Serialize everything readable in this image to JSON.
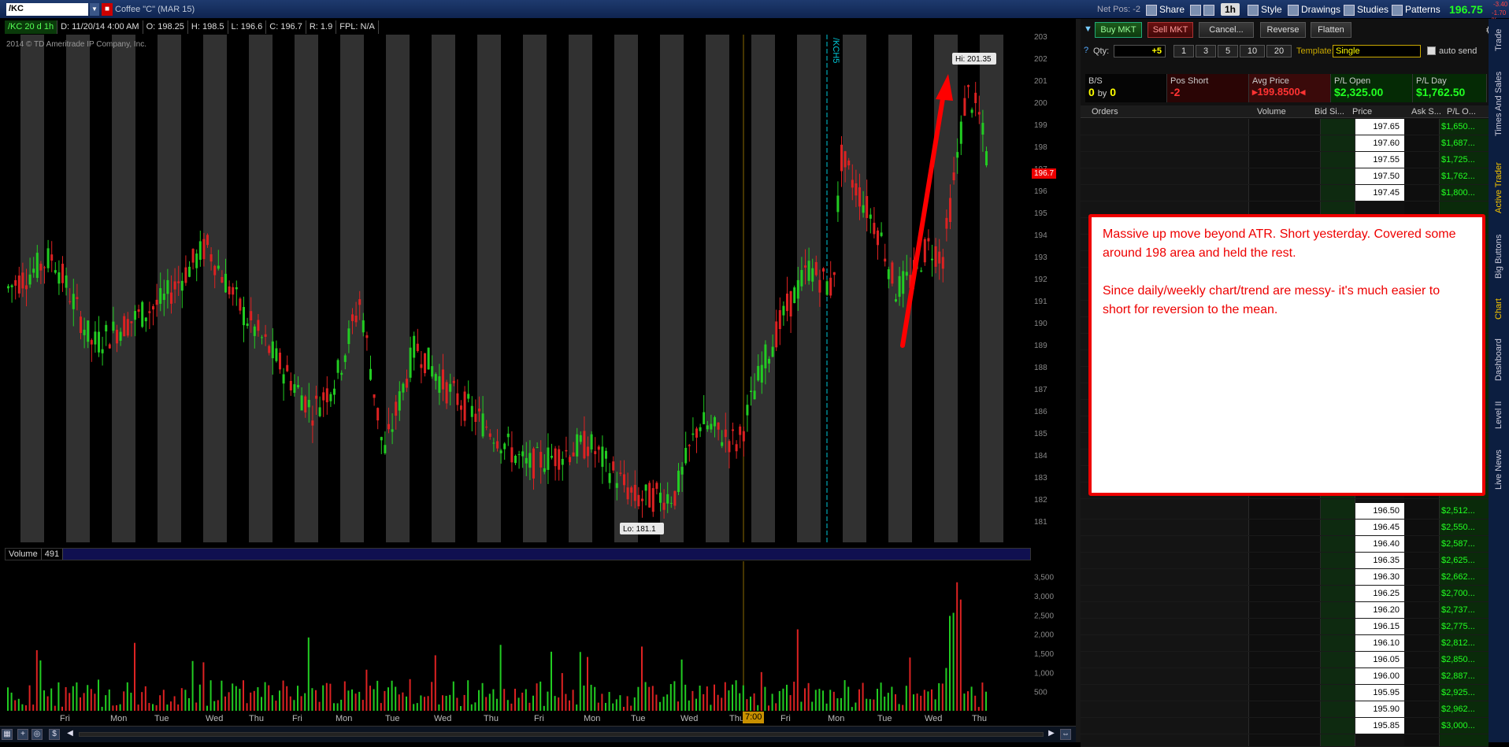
{
  "topbar": {
    "symbol": "/KC",
    "description": "Coffee \"C\" (MAR 15)",
    "net_pos": "Net Pos: -2",
    "share": "Share",
    "timeframe": "1h",
    "style": "Style",
    "drawings": "Drawings",
    "studies": "Studies",
    "patterns": "Patterns",
    "last_price": "196.75",
    "change_1": "-3.40",
    "change_2": "-1.70 %"
  },
  "infobar": {
    "period": "/KC 20 d 1h",
    "date": "D: 11/20/14 4:00 AM",
    "open": "O: 198.25",
    "high": "H: 198.5",
    "low": "L: 196.6",
    "close": "C: 196.7",
    "range": "R: 1.9",
    "fpl": "FPL: N/A"
  },
  "copyright": "2014 © TD Ameritrade IP Company, Inc.",
  "price_chart": {
    "y_ticks": [
      "203",
      "202",
      "201",
      "200",
      "199",
      "198",
      "197",
      "196",
      "195",
      "194",
      "193",
      "192",
      "191",
      "190",
      "189",
      "188",
      "187",
      "186",
      "185",
      "184",
      "183",
      "182",
      "181"
    ],
    "hi_label": "Hi: 201.35",
    "lo_label": "Lo: 181.1",
    "current_price": "196.7",
    "contract_label": "/KCH5",
    "colors": {
      "up": "#22cc22",
      "down": "#dd2222",
      "session_band": "#3a3a3a",
      "annotation": "#ff0000",
      "contract_line": "#00c8d8"
    }
  },
  "volume": {
    "label": "Volume",
    "value": "491",
    "y_ticks": [
      "3,500",
      "3,000",
      "2,500",
      "2,000",
      "1,500",
      "1,000",
      "500"
    ]
  },
  "x_axis": {
    "labels": [
      "Fri",
      "Mon",
      "Tue",
      "Wed",
      "Thu",
      "Fri",
      "Mon",
      "Tue",
      "Wed",
      "Thu",
      "Fri",
      "Mon",
      "Tue",
      "Wed",
      "Thu",
      "Fri",
      "Mon",
      "Tue",
      "Wed",
      "Thu"
    ],
    "time_marker": "7:00"
  },
  "active_trader": {
    "buy_mkt": "Buy MKT",
    "sell_mkt": "Sell MKT",
    "cancel": "Cancel...",
    "reverse": "Reverse",
    "flatten": "Flatten",
    "qty_label": "Qty:",
    "qty_value": "+5",
    "qty_buttons": [
      "1",
      "3",
      "5",
      "10",
      "20"
    ],
    "template_label": "Template:",
    "template_value": "Single",
    "auto_send": "auto send",
    "positions": [
      {
        "header": "B/S",
        "value_a": "0",
        "by": "by",
        "value_b": "0"
      },
      {
        "header": "Pos Short",
        "value": "-2"
      },
      {
        "header": "Avg Price",
        "value": "199.8500"
      },
      {
        "header": "P/L Open",
        "value": "$2,325.00"
      },
      {
        "header": "P/L Day",
        "value": "$1,762.50"
      }
    ],
    "ladder_headers": [
      "Orders",
      "Volume",
      "Bid Si...",
      "Price",
      "Ask S...",
      "P/L O..."
    ],
    "ladder_rows": [
      {
        "price": "197.65",
        "pl": "$1,650..."
      },
      {
        "price": "197.60",
        "pl": "$1,687..."
      },
      {
        "price": "197.55",
        "pl": "$1,725..."
      },
      {
        "price": "197.50",
        "pl": "$1,762..."
      },
      {
        "price": "197.45",
        "pl": "$1,800..."
      },
      {
        "price": "196.50",
        "pl": "$2,512..."
      },
      {
        "price": "196.45",
        "pl": "$2,550..."
      },
      {
        "price": "196.40",
        "pl": "$2,587..."
      },
      {
        "price": "196.35",
        "pl": "$2,625..."
      },
      {
        "price": "196.30",
        "pl": "$2,662..."
      },
      {
        "price": "196.25",
        "pl": "$2,700..."
      },
      {
        "price": "196.20",
        "pl": "$2,737..."
      },
      {
        "price": "196.15",
        "pl": "$2,775..."
      },
      {
        "price": "196.10",
        "pl": "$2,812..."
      },
      {
        "price": "196.05",
        "pl": "$2,850..."
      },
      {
        "price": "196.00",
        "pl": "$2,887..."
      },
      {
        "price": "195.95",
        "pl": "$2,925..."
      },
      {
        "price": "195.90",
        "pl": "$2,962..."
      },
      {
        "price": "195.85",
        "pl": "$3,000..."
      }
    ]
  },
  "note": {
    "line1": "Massive up move beyond ATR. Short yesterday. Covered some around 198 area and held the rest.",
    "line2": "Since daily/weekly chart/trend are messy- it's much easier to short for reversion to the mean."
  },
  "side_tabs": [
    "Trade",
    "Times And Sales",
    "Active Trader",
    "Big Buttons",
    "Chart",
    "Dashboard",
    "Level II",
    "Live News"
  ]
}
